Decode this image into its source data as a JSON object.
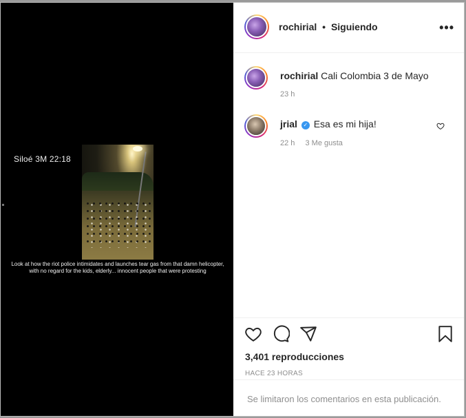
{
  "media": {
    "story_label": "Siloé 3M 22:18",
    "caption": "Look at how the riot police intimidates and launches tear gas from that damn helicopter, with no regard for the kids, elderly... innocent people that were protesting"
  },
  "header": {
    "username": "rochirial",
    "separator": "•",
    "follow_status": "Siguiendo",
    "more_label": "•••"
  },
  "comments": [
    {
      "username": "rochirial",
      "text": "Cali Colombia 3 de Mayo",
      "time": "23 h",
      "likes": ""
    },
    {
      "username": "jrial",
      "verified": true,
      "text": "Esa es mi hija!",
      "time": "22 h",
      "likes": "3 Me gusta"
    }
  ],
  "actions": {
    "icons": [
      "heart-icon",
      "comment-icon",
      "share-icon",
      "bookmark-icon"
    ],
    "views": "3,401 reproducciones",
    "posted_ago": "HACE 23 HORAS"
  },
  "footer": {
    "comments_limited": "Se limitaron los comentarios en esta publicación."
  }
}
